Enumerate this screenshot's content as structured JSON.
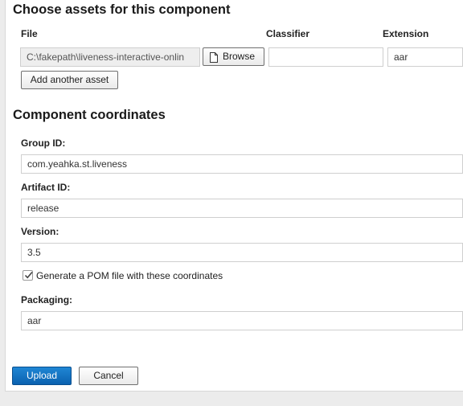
{
  "assets": {
    "heading": "Choose assets for this component",
    "columns": {
      "file": "File",
      "classifier": "Classifier",
      "extension": "Extension"
    },
    "file_value": "C:\\fakepath\\liveness-interactive-onlin",
    "browse_label": "Browse",
    "classifier_value": "",
    "extension_value": "aar",
    "add_asset_label": "Add another asset"
  },
  "coordinates": {
    "heading": "Component coordinates",
    "group_id_label": "Group ID:",
    "group_id_value": "com.yeahka.st.liveness",
    "artifact_id_label": "Artifact ID:",
    "artifact_id_value": "release",
    "version_label": "Version:",
    "version_value": "3.5",
    "generate_pom_label": "Generate a POM file with these coordinates",
    "generate_pom_checked": true,
    "packaging_label": "Packaging:",
    "packaging_value": "aar"
  },
  "actions": {
    "upload_label": "Upload",
    "cancel_label": "Cancel"
  },
  "icons": {
    "browse": "file-icon",
    "checkbox": "checkmark-icon"
  }
}
